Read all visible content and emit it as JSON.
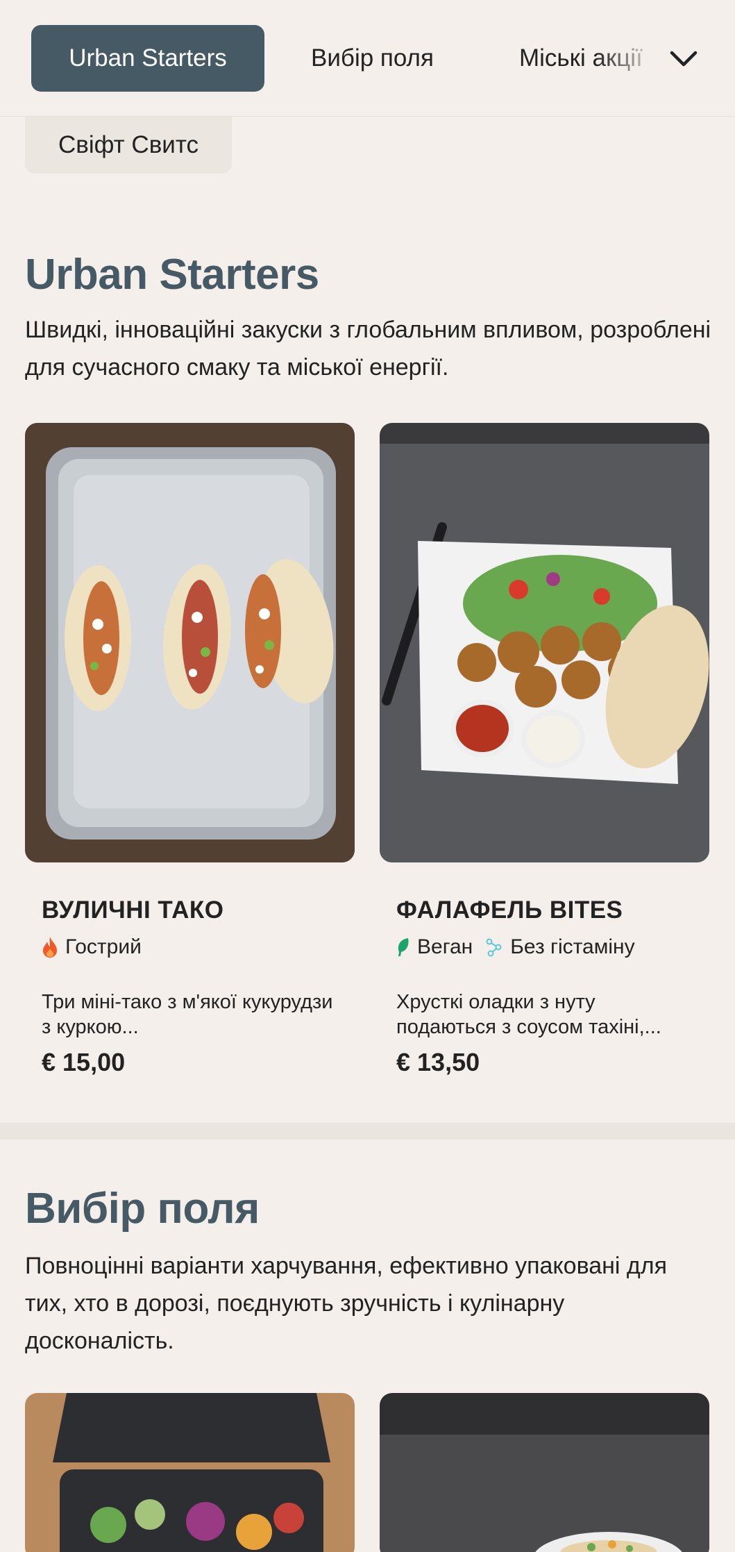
{
  "nav": {
    "active": "Urban Starters",
    "tab2": "Вибір поля",
    "tab3": "Міські акції"
  },
  "subtab": "Свіфт Свитс",
  "section1": {
    "title": "Urban Starters",
    "description": "Швидкі, інноваційні закуски з глобальним впливом, розроблені для сучасного смаку та міської енергії.",
    "items": [
      {
        "name": "ВУЛИЧНІ ТАКО",
        "tags": [
          "Гострий"
        ],
        "description": "Три міні-тако з м'якої кукурудзи з куркою...",
        "price": "€ 15,00"
      },
      {
        "name": "ФАЛАФЕЛЬ BITES",
        "tags": [
          "Веган",
          "Без гістаміну"
        ],
        "description": "Хрусткі оладки з нуту подаються з соусом тахіні,...",
        "price": "€ 13,50"
      }
    ]
  },
  "section2": {
    "title": "Вибір поля",
    "description": "Повноцінні варіанти харчування, ефективно упаковані для тих, хто в дорозі, поєднують зручність і кулінарну досконалість."
  },
  "icons": {
    "spicy": "flame-icon",
    "vegan": "leaf-icon",
    "histamine_free": "molecule-icon",
    "dropdown": "chevron-down-icon"
  },
  "colors": {
    "accent": "#465a66",
    "background": "#f4efeb",
    "spicy": "#f05a28",
    "vegan": "#1aa36a",
    "histamine": "#5bc8d8"
  }
}
